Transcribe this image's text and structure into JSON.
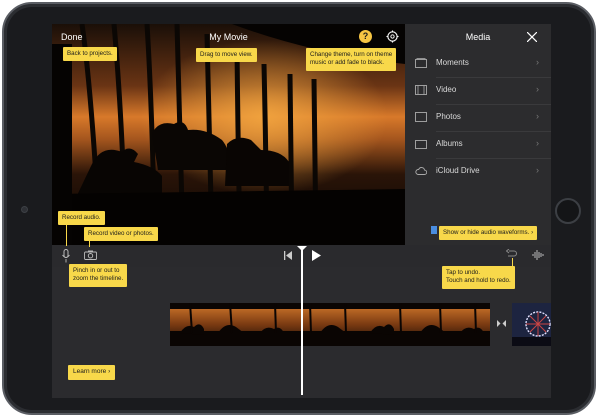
{
  "app": {
    "done_label": "Done",
    "movie_title": "My Movie",
    "help_glyph": "?"
  },
  "media_panel": {
    "title": "Media",
    "items": [
      {
        "label": "Moments",
        "icon": "moments-icon"
      },
      {
        "label": "Video",
        "icon": "film-icon"
      },
      {
        "label": "Photos",
        "icon": "photo-icon"
      },
      {
        "label": "Albums",
        "icon": "album-icon"
      },
      {
        "label": "iCloud Drive",
        "icon": "cloud-icon"
      }
    ]
  },
  "tips": {
    "back": "Back to projects.",
    "drag": "Drag to move view.",
    "theme_line1": "Change theme, turn on theme",
    "theme_line2": "music or add fade to black.",
    "record_audio": "Record audio.",
    "record_video": "Record video or photos.",
    "pinch_line1": "Pinch in or out to",
    "pinch_line2": "zoom the timeline.",
    "waveforms": "Show or hide audio waveforms.",
    "undo_line1": "Tap to undo.",
    "undo_line2": "Touch and hold to redo.",
    "learn_more": "Learn more"
  },
  "colors": {
    "tip_yellow": "#f8d84a",
    "help_yellow": "#f6c543",
    "screen_dark": "#2a2a2d",
    "sunset_orange": "#d8792a"
  }
}
